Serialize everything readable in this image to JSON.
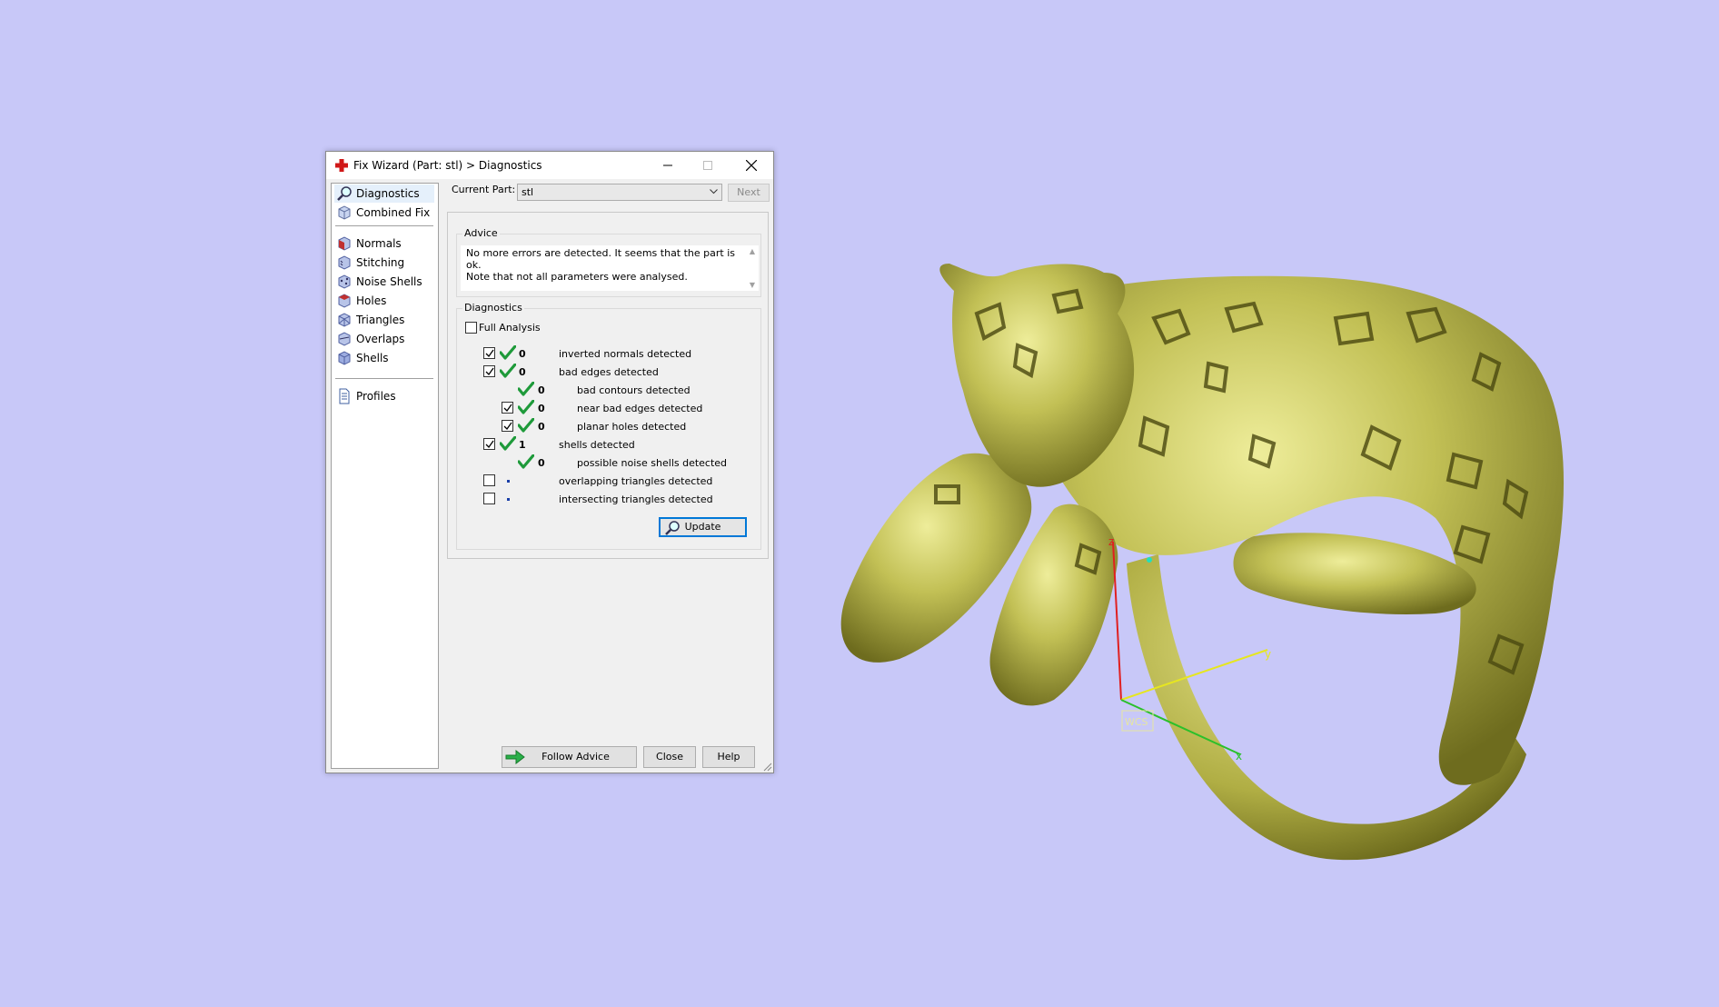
{
  "window": {
    "title": "Fix Wizard (Part: stl) > Diagnostics",
    "minimize_icon": "minimize-icon",
    "maximize_icon": "maximize-icon",
    "close_icon": "close-icon"
  },
  "sidebar": {
    "items": [
      {
        "label": "Diagnostics",
        "icon": "magnifier-icon",
        "selected": true
      },
      {
        "label": "Combined Fix",
        "icon": "cube-icon"
      },
      {
        "label": "Normals",
        "icon": "cube-normals-icon"
      },
      {
        "label": "Stitching",
        "icon": "cube-stitching-icon"
      },
      {
        "label": "Noise Shells",
        "icon": "cube-noise-icon"
      },
      {
        "label": "Holes",
        "icon": "cube-holes-icon"
      },
      {
        "label": "Triangles",
        "icon": "cube-triangles-icon"
      },
      {
        "label": "Overlaps",
        "icon": "cube-overlaps-icon"
      },
      {
        "label": "Shells",
        "icon": "cube-shells-icon"
      },
      {
        "label": "Profiles",
        "icon": "document-icon"
      }
    ]
  },
  "part": {
    "label": "Current Part:",
    "value": "stl",
    "next_label": "Next"
  },
  "advice": {
    "label": "Advice",
    "line1": "No more errors are detected. It seems that the part is ok.",
    "line2": "Note that not all parameters were analysed."
  },
  "diagnostics": {
    "label": "Diagnostics",
    "full_analysis_label": "Full Analysis",
    "full_analysis_checked": false,
    "rows": [
      {
        "checked": true,
        "status": "check",
        "count": "0",
        "label": "inverted normals detected"
      },
      {
        "checked": true,
        "status": "check",
        "count": "0",
        "label": "bad edges detected"
      },
      {
        "checked": null,
        "status": "check",
        "count": "0",
        "label": "bad contours detected"
      },
      {
        "checked": true,
        "status": "check",
        "count": "0",
        "label": "near bad edges detected"
      },
      {
        "checked": true,
        "status": "check",
        "count": "0",
        "label": "planar holes detected"
      },
      {
        "checked": true,
        "status": "check",
        "count": "1",
        "label": "shells detected"
      },
      {
        "checked": null,
        "status": "check",
        "count": "0",
        "label": "possible noise shells detected"
      },
      {
        "checked": false,
        "status": "dot",
        "count": "",
        "label": "overlapping triangles detected"
      },
      {
        "checked": false,
        "status": "dot",
        "count": "",
        "label": "intersecting triangles detected"
      }
    ],
    "update_label": "Update"
  },
  "footer": {
    "follow_advice_label": "Follow Advice",
    "close_label": "Close",
    "help_label": "Help"
  },
  "viewport": {
    "background": "#c8c8f8",
    "model_color": "#b8b64a",
    "axis_labels": {
      "x": "x",
      "y": "y",
      "z": "z",
      "wcs": "WCS"
    }
  }
}
